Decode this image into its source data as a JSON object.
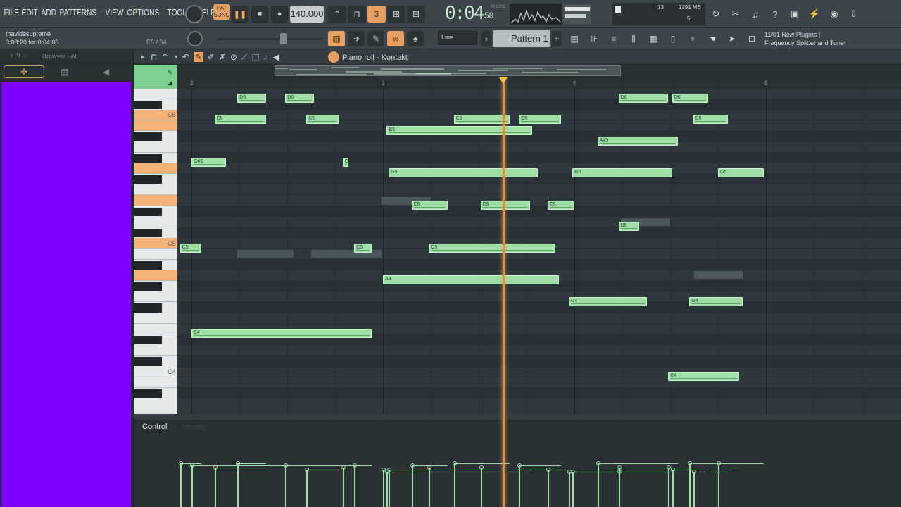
{
  "menu": [
    "FILE",
    "EDIT",
    "ADD",
    "PATTERNS",
    "VIEW",
    "OPTIONS",
    "TOOLS",
    "HELP"
  ],
  "transport": {
    "pat_label": "PAT",
    "song_label": "SONG",
    "tempo": "140.000",
    "time": "0:04",
    "time_fraction": "58",
    "time_units": "M:S:CS"
  },
  "monitor": {
    "cpu": "13",
    "memory": "1291 MB",
    "polyphony": "5"
  },
  "user": {
    "name": "thavidesupreme",
    "session_time": "3:08:20 for 0:04:06",
    "hint_count": "E5 / 64"
  },
  "snap": {
    "value": "Line"
  },
  "pattern": {
    "name": "Pattern 1"
  },
  "news": {
    "line1": "11/01  New Plugins |",
    "line2": "Frequency Splitter and Tuner"
  },
  "browser": {
    "title": "Browser - All"
  },
  "piano_roll": {
    "title": "Piano roll - Kontakt",
    "bar_numbers": [
      "2",
      "3",
      "4",
      "5"
    ],
    "key_labels": [
      "C6",
      "C5",
      "C4"
    ]
  },
  "control": {
    "label": "Control",
    "velocity_label": "Velocity"
  },
  "notes": [
    {
      "pitch": "D6",
      "bar": 1.24,
      "len": 0.15
    },
    {
      "pitch": "D6",
      "bar": 1.49,
      "len": 0.15
    },
    {
      "pitch": "C6",
      "bar": 1.12,
      "len": 0.27
    },
    {
      "pitch": "C6",
      "bar": 1.6,
      "len": 0.17
    },
    {
      "pitch": "B5",
      "bar": 2.02,
      "len": 0.76
    },
    {
      "pitch": "C6",
      "bar": 2.37,
      "len": 0.29
    },
    {
      "pitch": "C6",
      "bar": 2.71,
      "len": 0.22
    },
    {
      "pitch": "D6",
      "bar": 3.23,
      "len": 0.26
    },
    {
      "pitch": "D6",
      "bar": 3.51,
      "len": 0.19
    },
    {
      "pitch": "C6",
      "bar": 3.62,
      "len": 0.18
    },
    {
      "pitch": "A#5",
      "bar": 3.12,
      "len": 0.42
    },
    {
      "pitch": "G#5",
      "bar": 1.0,
      "len": 0.18
    },
    {
      "pitch": "G#5",
      "bar": 1.79,
      "len": 0.03
    },
    {
      "pitch": "G5",
      "bar": 2.03,
      "len": 0.78
    },
    {
      "pitch": "G5",
      "bar": 2.99,
      "len": 0.52
    },
    {
      "pitch": "G5",
      "bar": 3.75,
      "len": 0.24
    },
    {
      "pitch": "E5",
      "bar": 2.15,
      "len": 0.19
    },
    {
      "pitch": "E5",
      "bar": 2.51,
      "len": 0.26
    },
    {
      "pitch": "E5",
      "bar": 2.86,
      "len": 0.14
    },
    {
      "pitch": "D5",
      "bar": 3.23,
      "len": 0.11
    },
    {
      "pitch": "C5",
      "bar": 0.94,
      "len": 0.11
    },
    {
      "pitch": "C5",
      "bar": 1.85,
      "len": 0.09
    },
    {
      "pitch": "C5",
      "bar": 2.24,
      "len": 0.66
    },
    {
      "pitch": "A4",
      "bar": 2.0,
      "len": 0.92
    },
    {
      "pitch": "G4",
      "bar": 2.97,
      "len": 0.41
    },
    {
      "pitch": "G4",
      "bar": 3.6,
      "len": 0.28
    },
    {
      "pitch": "E4",
      "bar": 1.0,
      "len": 0.94
    },
    {
      "pitch": "C4",
      "bar": 3.49,
      "len": 0.37
    }
  ],
  "colors": {
    "note": "#9fe0a7",
    "playhead": "#e58e3c",
    "accent": "#f2a65a",
    "selection": "#8000ff"
  }
}
